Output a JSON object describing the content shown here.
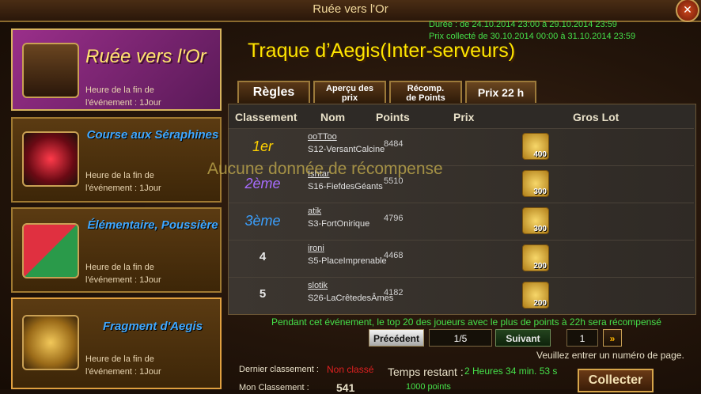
{
  "window": {
    "title": "Ruée vers l'Or",
    "close_label": "✕"
  },
  "dates": {
    "duration": "Durée : de 24.10.2014 23:00 à 29.10.2014 23:59",
    "collect": "Prix collecté de 30.10.2014 00:00 à 31.10.2014 23:59"
  },
  "sidebar": {
    "items": [
      {
        "title": "Ruée vers l'Or",
        "sub1": "Heure de la fin de",
        "sub2": "l'événement : 1Jour"
      },
      {
        "title": "Course aux Séraphines",
        "sub1": "Heure de la fin de",
        "sub2": "l'événement : 1Jour"
      },
      {
        "title": "Élémentaire, Poussière",
        "sub1": "Heure de la fin de",
        "sub2": "l'événement : 1Jour"
      },
      {
        "title": "Fragment d'Aegis",
        "sub1": "Heure de la fin de",
        "sub2": "l'événement : 1Jour"
      }
    ]
  },
  "main": {
    "title": "Traque d’Aegis(Inter-serveurs)",
    "tabs": [
      "Règles",
      "Aperçu des prix",
      "Récomp. de Points",
      "Prix 22 h"
    ],
    "headers": [
      "Classement",
      "Nom",
      "Points",
      "Prix",
      "Gros Lot"
    ],
    "overlay": "Aucune donnée de récompense",
    "rows": [
      {
        "rank": "1er",
        "name": "ooTToo",
        "server": "S12-VersantCalcine",
        "points": "8484",
        "prize": "400"
      },
      {
        "rank": "2ème",
        "name": "Ishtar",
        "server": "S16-FiefdesGéants",
        "points": "5510",
        "prize": "300"
      },
      {
        "rank": "3ème",
        "name": "atik",
        "server": "S3-FortOnirique",
        "points": "4796",
        "prize": "300"
      },
      {
        "rank": "4",
        "name": "ironi",
        "server": "S5-PlaceImprenable",
        "points": "4468",
        "prize": "200"
      },
      {
        "rank": "5",
        "name": "slotik",
        "server": "S26-LaCrêtedesÂmes",
        "points": "4182",
        "prize": "200"
      }
    ],
    "notice": "Pendant cet événement, le top 20 des joueurs avec le plus de points à 22h sera récompensé",
    "pager": {
      "prev": "Précédent",
      "page": "1/5",
      "next": "Suivant",
      "input_value": "1",
      "jump": "»",
      "hint": "Veuillez entrer un numéro de page."
    }
  },
  "footer": {
    "last_label": "Dernier classement :",
    "last_value": "Non classé",
    "time_label": "Temps restant :",
    "time_value": "2 Heures 34 min. 53 s",
    "my_label": "Mon Classement :",
    "my_value": "541",
    "points_value": "1000 points",
    "collect": "Collecter"
  },
  "colors": {
    "accent_gold": "#ffe600",
    "rank1": "#ffd200",
    "rank2": "#a86cff",
    "rank3": "#3aa0ff"
  }
}
